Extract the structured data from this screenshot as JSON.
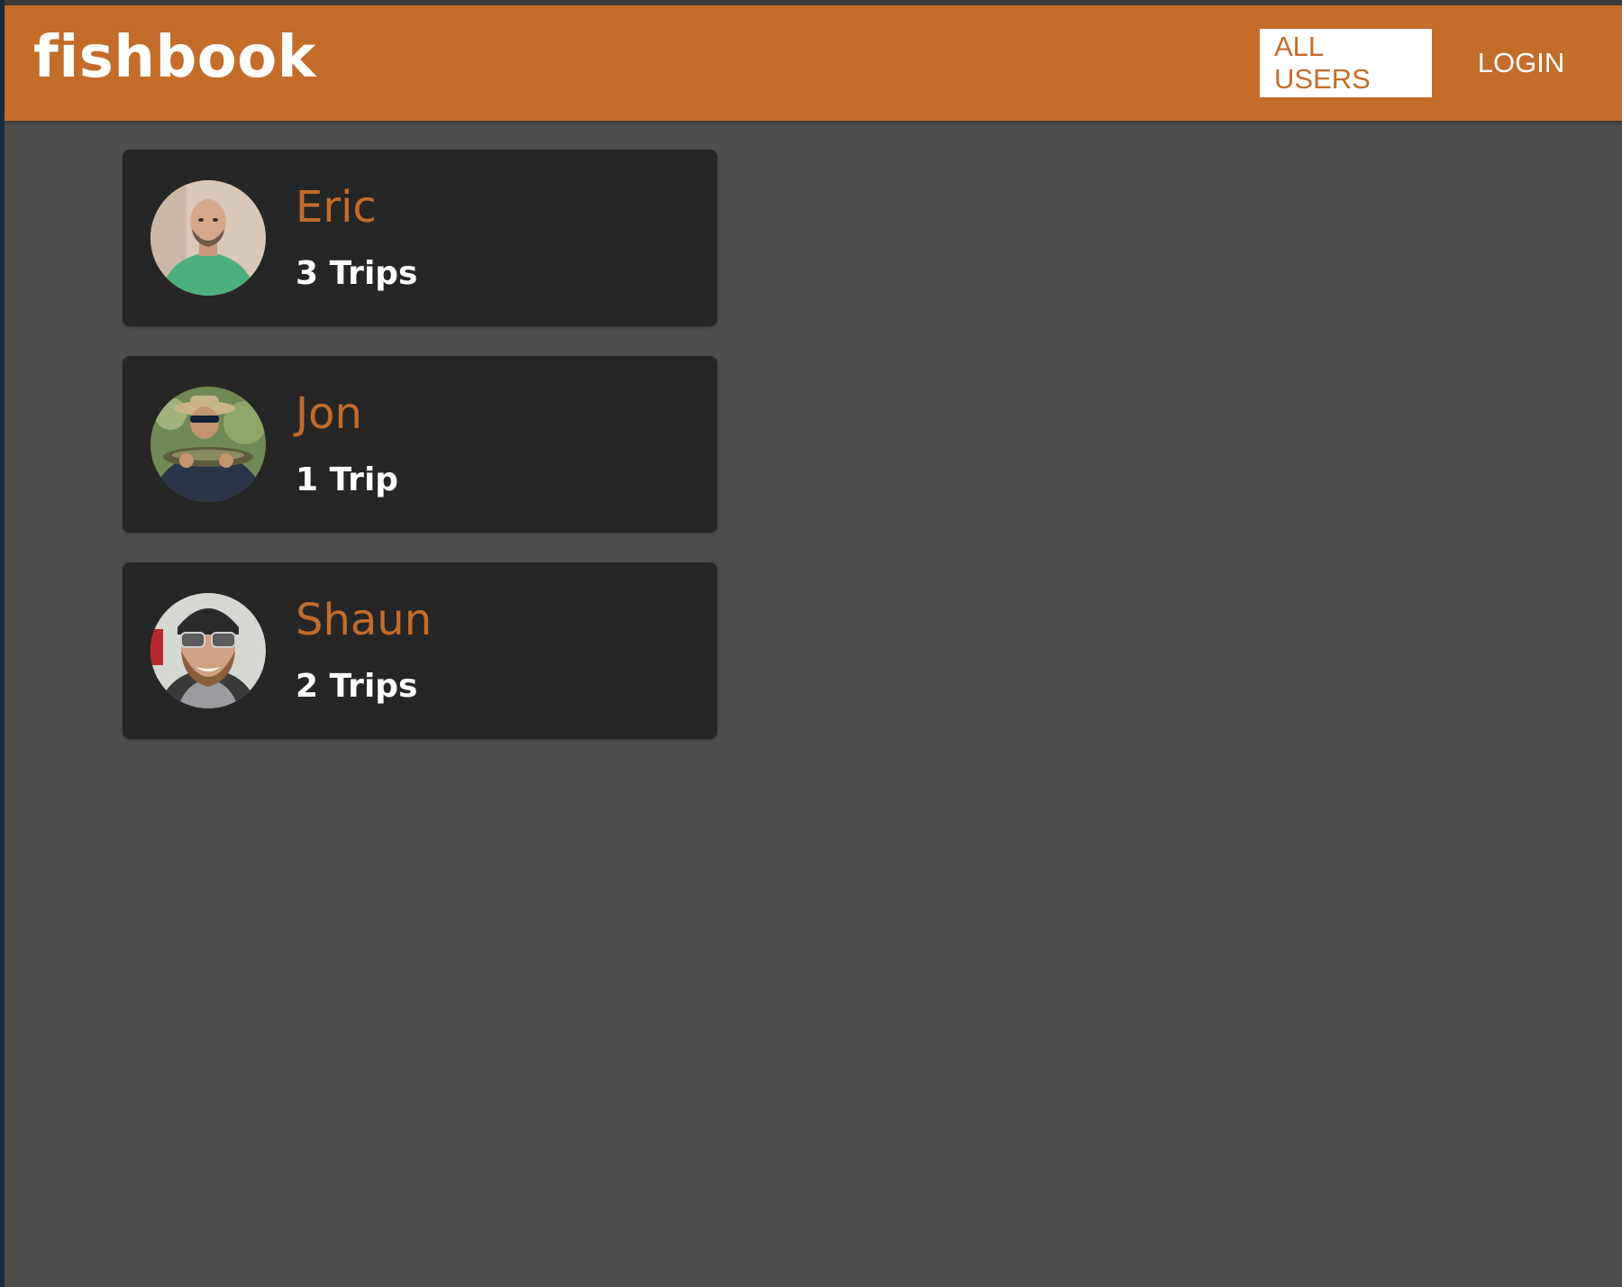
{
  "app": {
    "brand": "fishbook",
    "accent_color": "#c46c2a",
    "background_color": "#4e4e4e",
    "card_color": "#262626"
  },
  "nav": {
    "all_users_label": "ALL USERS",
    "login_label": "LOGIN"
  },
  "users": [
    {
      "name": "Eric",
      "trips": "3 Trips"
    },
    {
      "name": "Jon",
      "trips": "1 Trip"
    },
    {
      "name": "Shaun",
      "trips": "2 Trips"
    }
  ]
}
